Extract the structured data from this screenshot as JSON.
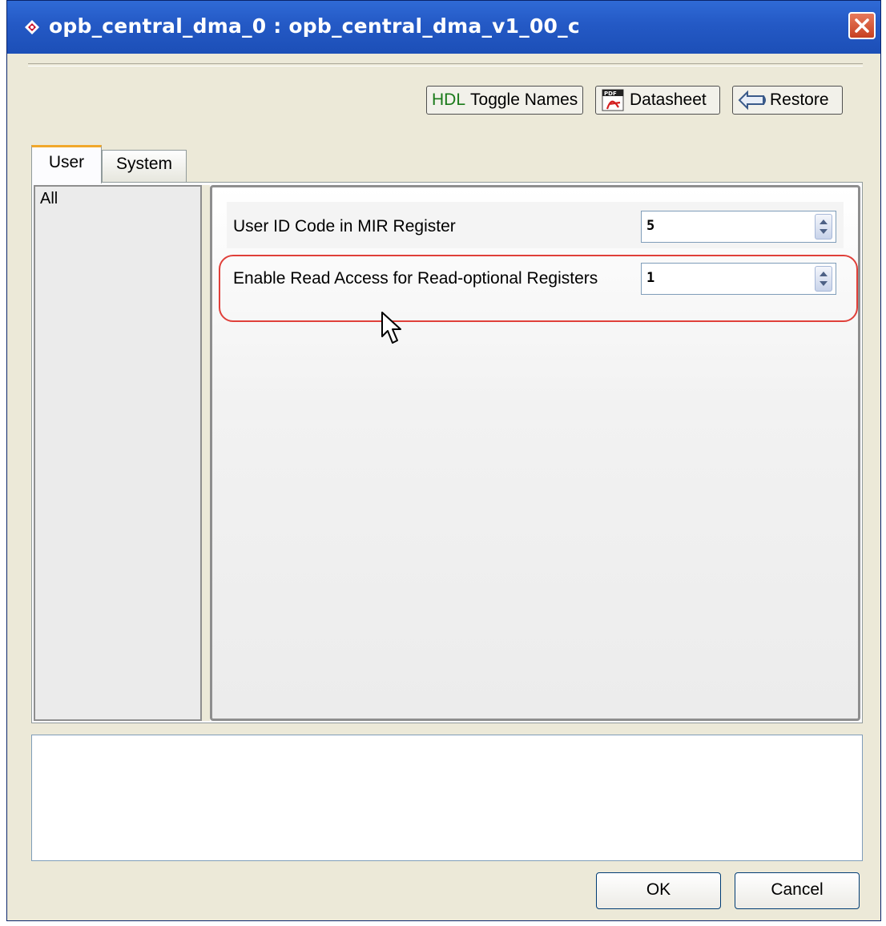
{
  "window": {
    "title": "opb_central_dma_0 : opb_central_dma_v1_00_c"
  },
  "toolbar": {
    "toggle_names_prefix": "HDL",
    "toggle_names_label": "Toggle Names",
    "datasheet_label": "Datasheet",
    "restore_label": "Restore"
  },
  "tabs": [
    {
      "label": "User",
      "selected": true
    },
    {
      "label": "System",
      "selected": false
    }
  ],
  "category_list": {
    "items": [
      "All"
    ]
  },
  "parameters": [
    {
      "label": "User ID Code in MIR Register",
      "value": "5"
    },
    {
      "label": "Enable Read Access for Read-optional Registers",
      "value": "1",
      "highlighted": true
    }
  ],
  "buttons": {
    "ok_label": "OK",
    "cancel_label": "Cancel"
  },
  "colors": {
    "titlebar": "#2459c5",
    "highlight": "#e0403a",
    "hdl_text": "#1a7a1a"
  }
}
